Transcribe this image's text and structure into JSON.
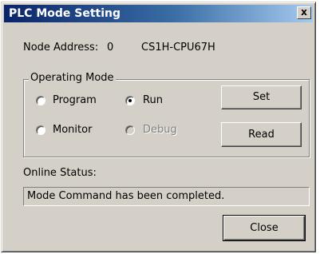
{
  "window": {
    "title": "PLC Mode Setting",
    "close_glyph": "x"
  },
  "node": {
    "address_label": "Node Address:",
    "address_value": "0",
    "model": "CS1H-CPU67H"
  },
  "operating_mode": {
    "legend": "Operating Mode",
    "options": [
      {
        "label": "Program",
        "checked": false,
        "enabled": true
      },
      {
        "label": "Run",
        "checked": true,
        "enabled": true
      },
      {
        "label": "Monitor",
        "checked": false,
        "enabled": true
      },
      {
        "label": "Debug",
        "checked": false,
        "enabled": false
      }
    ],
    "set_label": "Set",
    "read_label": "Read"
  },
  "online_status": {
    "label": "Online Status:",
    "message": "Mode Command has been completed."
  },
  "close_label": "Close",
  "colors": {
    "face": "#d4d0c8",
    "title_start": "#0a246a",
    "title_end": "#a6caf0",
    "disabled_text": "#808080"
  }
}
